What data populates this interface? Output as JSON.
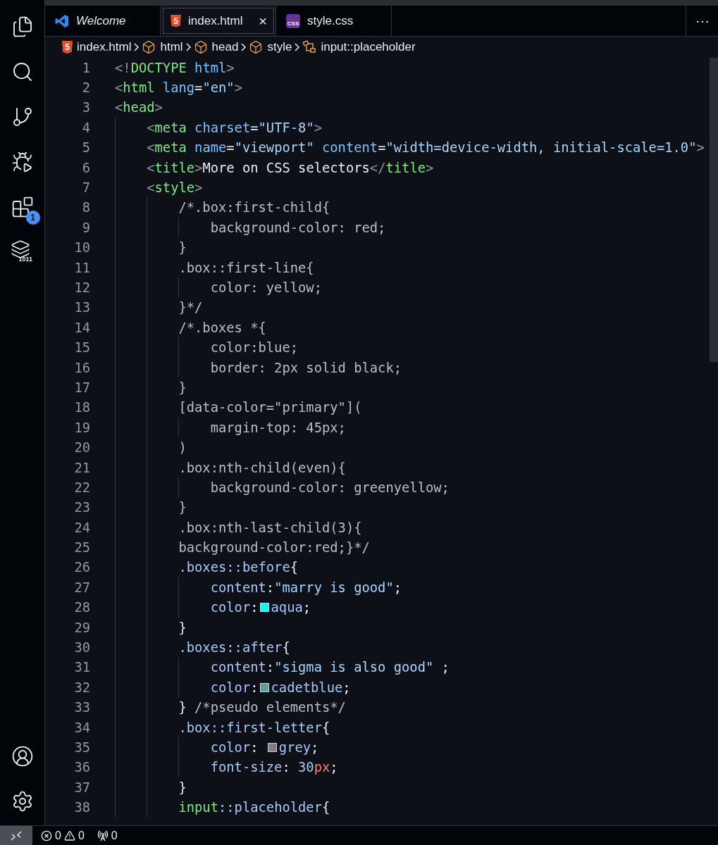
{
  "activity_bar": {
    "top": [
      {
        "kind": "files"
      },
      {
        "kind": "search"
      },
      {
        "kind": "source-control"
      },
      {
        "kind": "run-debug"
      },
      {
        "kind": "extensions",
        "badge": "1"
      },
      {
        "kind": "database",
        "label": "1011"
      }
    ],
    "bottom": [
      {
        "kind": "account"
      },
      {
        "kind": "settings"
      }
    ]
  },
  "tabs": [
    {
      "label": "Welcome",
      "kind": "vscode",
      "preview": true,
      "selected": false
    },
    {
      "label": "index.html",
      "kind": "html",
      "icon_text": "5",
      "close": "×",
      "preview": false,
      "selected": true
    },
    {
      "label": "style.css",
      "kind": "css",
      "icon_text": "CSS",
      "preview": false,
      "selected": false
    }
  ],
  "tab_actions": "⋯",
  "breadcrumb": [
    {
      "kind": "html",
      "icon_text": "5",
      "label": "index.html"
    },
    {
      "kind": "element",
      "label": "html"
    },
    {
      "kind": "element",
      "label": "head"
    },
    {
      "kind": "element",
      "label": "style"
    },
    {
      "kind": "selector",
      "label": "input::placeholder"
    }
  ],
  "code_lines": [
    {
      "n": "1",
      "tokens": [
        {
          "kind": "br",
          "t": "<!"
        },
        {
          "kind": "tag",
          "t": "DOCTYPE"
        },
        {
          "kind": "attr",
          "t": " html"
        },
        {
          "kind": "br",
          "t": ">"
        }
      ]
    },
    {
      "n": "2",
      "tokens": [
        {
          "kind": "br",
          "t": "<"
        },
        {
          "kind": "tag",
          "t": "html"
        },
        {
          "kind": "attr",
          "t": " lang"
        },
        {
          "kind": "p",
          "t": "="
        },
        {
          "kind": "str",
          "t": "\"en\""
        },
        {
          "kind": "br",
          "t": ">"
        }
      ]
    },
    {
      "n": "3",
      "tokens": [
        {
          "kind": "br",
          "t": "<"
        },
        {
          "kind": "tag",
          "t": "head"
        },
        {
          "kind": "br",
          "t": ">"
        }
      ]
    },
    {
      "n": "4",
      "tokens": [
        {
          "kind": "br",
          "t": "    <"
        },
        {
          "kind": "tag",
          "t": "meta"
        },
        {
          "kind": "attr",
          "t": " charset"
        },
        {
          "kind": "p",
          "t": "="
        },
        {
          "kind": "str",
          "t": "\"UTF-8\""
        },
        {
          "kind": "br",
          "t": ">"
        }
      ]
    },
    {
      "n": "5",
      "tokens": [
        {
          "kind": "br",
          "t": "    <"
        },
        {
          "kind": "tag",
          "t": "meta"
        },
        {
          "kind": "attr",
          "t": " name"
        },
        {
          "kind": "p",
          "t": "="
        },
        {
          "kind": "str",
          "t": "\"viewport\""
        },
        {
          "kind": "attr",
          "t": " content"
        },
        {
          "kind": "p",
          "t": "="
        },
        {
          "kind": "str",
          "t": "\"width=device-width, initial-scale=1.0\""
        },
        {
          "kind": "br",
          "t": ">"
        }
      ]
    },
    {
      "n": "6",
      "tokens": [
        {
          "kind": "br",
          "t": "    <"
        },
        {
          "kind": "tag",
          "t": "title"
        },
        {
          "kind": "br",
          "t": ">"
        },
        {
          "kind": "txt",
          "t": "More on CSS selectors"
        },
        {
          "kind": "br",
          "t": "</"
        },
        {
          "kind": "tag",
          "t": "title"
        },
        {
          "kind": "br",
          "t": ">"
        }
      ]
    },
    {
      "n": "7",
      "tokens": [
        {
          "kind": "br",
          "t": "    <"
        },
        {
          "kind": "tag",
          "t": "style"
        },
        {
          "kind": "br",
          "t": ">"
        }
      ]
    },
    {
      "n": "8",
      "tokens": [
        {
          "kind": "cmt",
          "t": "        /*.box:first-child{"
        }
      ]
    },
    {
      "n": "9",
      "tokens": [
        {
          "kind": "cmt",
          "t": "            background-color: red;"
        }
      ]
    },
    {
      "n": "10",
      "tokens": [
        {
          "kind": "cmt",
          "t": "        }"
        }
      ]
    },
    {
      "n": "11",
      "tokens": [
        {
          "kind": "cmt",
          "t": "        .box::first-line{"
        }
      ]
    },
    {
      "n": "12",
      "tokens": [
        {
          "kind": "cmt",
          "t": "            color: yellow;"
        }
      ]
    },
    {
      "n": "13",
      "tokens": [
        {
          "kind": "cmt",
          "t": "        }*/"
        }
      ]
    },
    {
      "n": "14",
      "tokens": [
        {
          "kind": "cmt",
          "t": "        /*.boxes *{"
        }
      ]
    },
    {
      "n": "15",
      "tokens": [
        {
          "kind": "cmt",
          "t": "            color:blue;"
        }
      ]
    },
    {
      "n": "16",
      "tokens": [
        {
          "kind": "cmt",
          "t": "            border: 2px solid black;"
        }
      ]
    },
    {
      "n": "17",
      "tokens": [
        {
          "kind": "cmt",
          "t": "        }"
        }
      ]
    },
    {
      "n": "18",
      "tokens": [
        {
          "kind": "cmt",
          "t": "        [data-color=\"primary\"]("
        }
      ]
    },
    {
      "n": "19",
      "tokens": [
        {
          "kind": "cmt",
          "t": "            margin-top: 45px;"
        }
      ]
    },
    {
      "n": "20",
      "tokens": [
        {
          "kind": "cmt",
          "t": "        )"
        }
      ]
    },
    {
      "n": "21",
      "tokens": [
        {
          "kind": "cmt",
          "t": "        .box:nth-child(even){"
        }
      ]
    },
    {
      "n": "22",
      "tokens": [
        {
          "kind": "cmt",
          "t": "            background-color: greenyellow;"
        }
      ]
    },
    {
      "n": "23",
      "tokens": [
        {
          "kind": "cmt",
          "t": "        }"
        }
      ]
    },
    {
      "n": "24",
      "tokens": [
        {
          "kind": "cmt",
          "t": "        .box:nth-last-child(3){"
        }
      ]
    },
    {
      "n": "25",
      "tokens": [
        {
          "kind": "cmt",
          "t": "        background-color:red;}*/"
        }
      ]
    },
    {
      "n": "26",
      "tokens": [
        {
          "kind": "sel",
          "t": "        .boxes::before"
        },
        {
          "kind": "p",
          "t": "{"
        }
      ]
    },
    {
      "n": "27",
      "tokens": [
        {
          "kind": "prop",
          "t": "            content"
        },
        {
          "kind": "p",
          "t": ":"
        },
        {
          "kind": "str",
          "t": "\"marry is good\""
        },
        {
          "kind": "p",
          "t": ";"
        }
      ]
    },
    {
      "n": "28",
      "tokens": [
        {
          "kind": "prop",
          "t": "            color"
        },
        {
          "kind": "p",
          "t": ":"
        },
        {
          "kind": "sw",
          "color": "#00ffff"
        },
        {
          "kind": "val",
          "t": "aqua"
        },
        {
          "kind": "p",
          "t": ";"
        }
      ]
    },
    {
      "n": "29",
      "tokens": [
        {
          "kind": "p",
          "t": "        }"
        }
      ]
    },
    {
      "n": "30",
      "tokens": [
        {
          "kind": "sel",
          "t": "        .boxes::after"
        },
        {
          "kind": "p",
          "t": "{"
        }
      ]
    },
    {
      "n": "31",
      "tokens": [
        {
          "kind": "prop",
          "t": "            content"
        },
        {
          "kind": "p",
          "t": ":"
        },
        {
          "kind": "str",
          "t": "\"sigma is also good\""
        },
        {
          "kind": "p",
          "t": " ;"
        }
      ]
    },
    {
      "n": "32",
      "tokens": [
        {
          "kind": "prop",
          "t": "            color"
        },
        {
          "kind": "p",
          "t": ":"
        },
        {
          "kind": "sw",
          "color": "#5f9ea0"
        },
        {
          "kind": "val",
          "t": "cadetblue"
        },
        {
          "kind": "p",
          "t": ";"
        }
      ]
    },
    {
      "n": "33",
      "tokens": [
        {
          "kind": "p",
          "t": "        }"
        },
        {
          "kind": "cmt",
          "t": " /*pseudo elements*/"
        }
      ]
    },
    {
      "n": "34",
      "tokens": [
        {
          "kind": "sel",
          "t": "        .box::first-letter"
        },
        {
          "kind": "p",
          "t": "{"
        }
      ]
    },
    {
      "n": "35",
      "tokens": [
        {
          "kind": "prop",
          "t": "            color"
        },
        {
          "kind": "p",
          "t": ": "
        },
        {
          "kind": "sw",
          "color": "#808080"
        },
        {
          "kind": "val",
          "t": "grey"
        },
        {
          "kind": "p",
          "t": ";"
        }
      ]
    },
    {
      "n": "36",
      "tokens": [
        {
          "kind": "prop",
          "t": "            font-size"
        },
        {
          "kind": "p",
          "t": ": "
        },
        {
          "kind": "num",
          "t": "30"
        },
        {
          "kind": "unit",
          "t": "px"
        },
        {
          "kind": "p",
          "t": ";"
        }
      ]
    },
    {
      "n": "37",
      "tokens": [
        {
          "kind": "p",
          "t": "        }"
        }
      ]
    },
    {
      "n": "38",
      "tokens": [
        {
          "kind": "tag",
          "t": "        input"
        },
        {
          "kind": "sel",
          "t": "::placeholder"
        },
        {
          "kind": "p",
          "t": "{"
        }
      ]
    }
  ],
  "status_bar": {
    "errors": "0",
    "warnings": "0",
    "ports": "0"
  }
}
